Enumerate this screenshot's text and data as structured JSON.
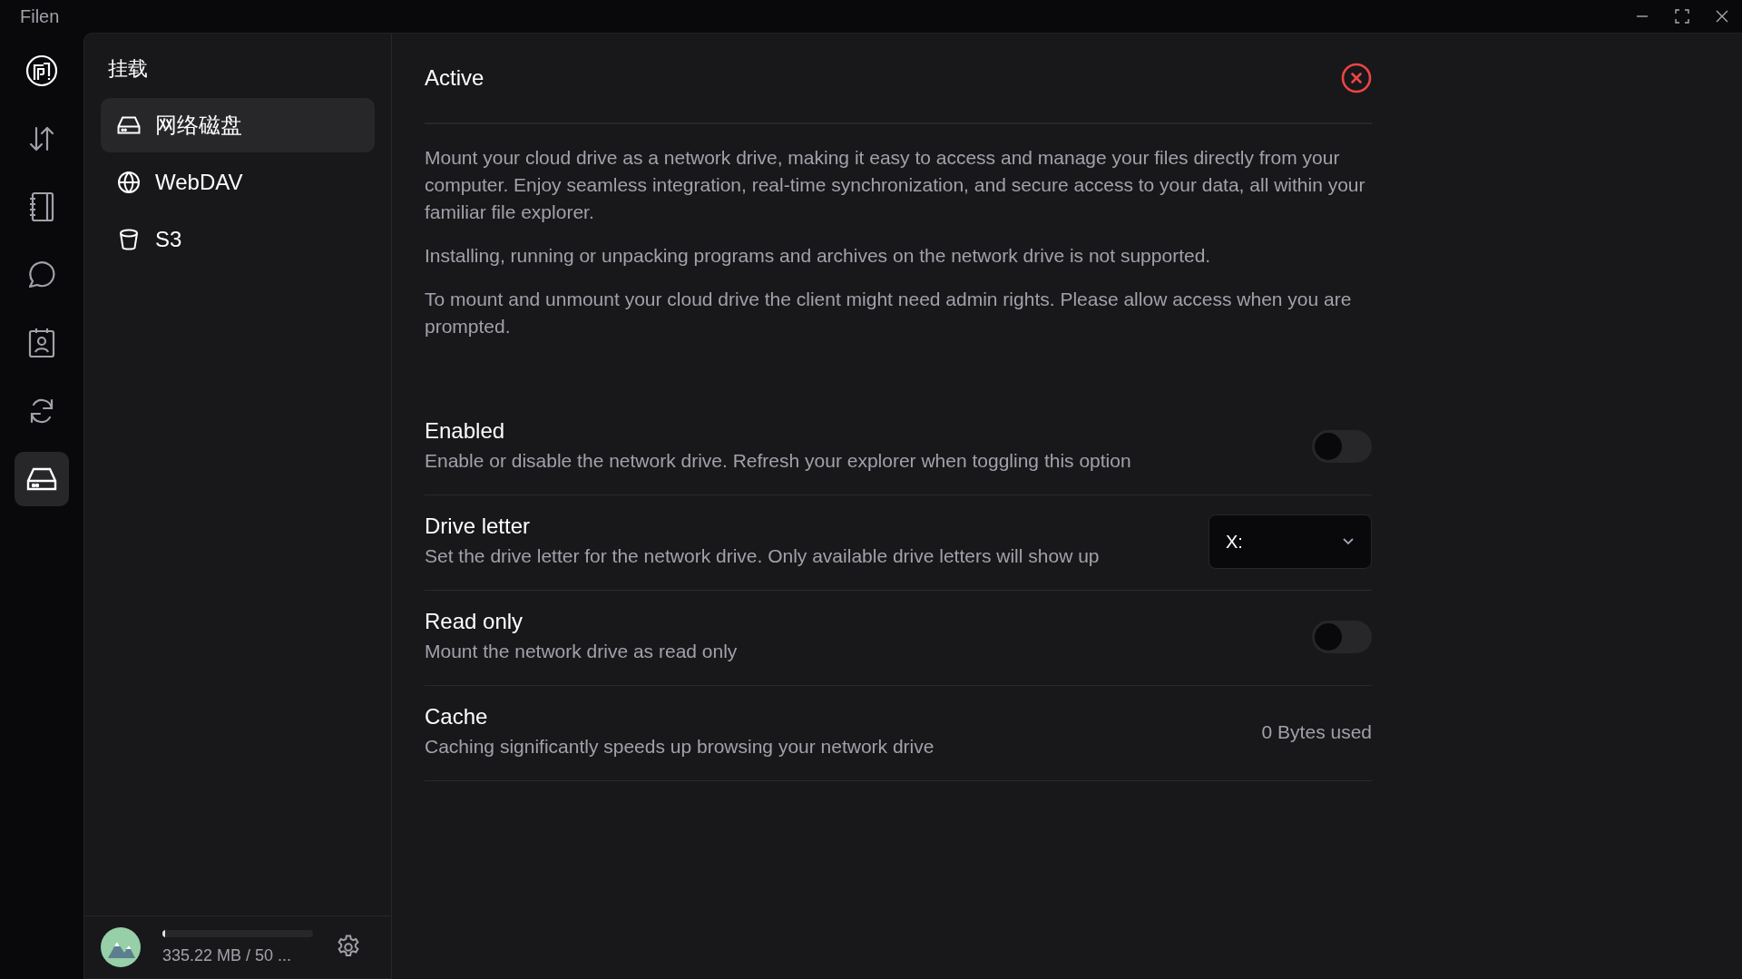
{
  "window": {
    "title": "Filen"
  },
  "rail": [
    {
      "kind": "logo",
      "selected": false
    },
    {
      "kind": "transfers",
      "selected": false
    },
    {
      "kind": "notes",
      "selected": false
    },
    {
      "kind": "chats",
      "selected": false
    },
    {
      "kind": "contacts",
      "selected": false
    },
    {
      "kind": "sync",
      "selected": false
    },
    {
      "kind": "mounts",
      "selected": true
    }
  ],
  "sidebar": {
    "title": "挂载",
    "items": [
      {
        "label": "网络磁盘",
        "kind": "drive",
        "selected": true
      },
      {
        "label": "WebDAV",
        "kind": "globe",
        "selected": false
      },
      {
        "label": "S3",
        "kind": "bucket",
        "selected": false
      }
    ]
  },
  "storage": {
    "level": 0.01,
    "text": "335.22 MB / 50 ..."
  },
  "main": {
    "status": "Active",
    "paragraphs": [
      "Mount your cloud drive as a network drive, making it easy to access and manage your files directly from your computer. Enjoy seamless integration, real-time synchronization, and secure access to your data, all within your familiar file explorer.",
      "Installing, running or unpacking programs and archives on the network drive is not supported.",
      "To mount and unmount your cloud drive the client might need admin rights. Please allow access when you are prompted."
    ],
    "settings": [
      {
        "kind": "toggle",
        "title": "Enabled",
        "description": "Enable or disable the network drive. Refresh your explorer when toggling this option",
        "on": false
      },
      {
        "kind": "select",
        "title": "Drive letter",
        "description": "Set the drive letter for the network drive. Only available drive letters will show up",
        "value": "X:"
      },
      {
        "kind": "toggle",
        "title": "Read only",
        "description": "Mount the network drive as read only",
        "on": false
      },
      {
        "kind": "text",
        "title": "Cache",
        "description": "Caching significantly speeds up browsing your network drive",
        "value": "0 Bytes used"
      }
    ]
  }
}
